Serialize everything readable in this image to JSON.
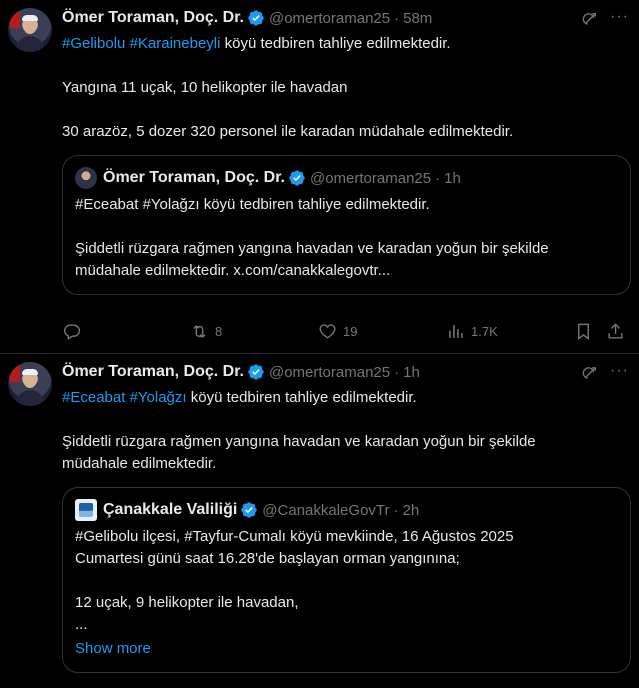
{
  "tweets": [
    {
      "author": "Ömer Toraman, Doç. Dr.",
      "handle": "@omertoraman25",
      "dot": "·",
      "time": "58m",
      "more": "···",
      "line1_tags": [
        "#Gelibolu",
        "#Karainebeyli"
      ],
      "line1_rest": " köyü tedbiren tahliye edilmektedir.",
      "line2": "Yangına 11 uçak, 10 helikopter ile havadan",
      "line3": "30 arazöz, 5 dozer 320 personel ile karadan müdahale edilmektedir.",
      "quote": {
        "author": "Ömer Toraman, Doç. Dr.",
        "handle": "@omertoraman25",
        "dot": "·",
        "time": "1h",
        "line1": "#Eceabat #Yolağzı köyü tedbiren tahliye edilmektedir.",
        "line2": "Şiddetli rüzgara rağmen yangına havadan ve karadan yoğun bir şekilde",
        "line3": "müdahale edilmektedir. x.com/canakkalegovtr..."
      },
      "stats": {
        "retweets": "8",
        "likes": "19",
        "views": "1.7K"
      }
    },
    {
      "author": "Ömer Toraman, Doç. Dr.",
      "handle": "@omertoraman25",
      "dot": "·",
      "time": "1h",
      "more": "···",
      "line1_tags": [
        "#Eceabat",
        "#Yolağzı"
      ],
      "line1_rest": " köyü tedbiren tahliye edilmektedir.",
      "line2": "Şiddetli rüzgara rağmen yangına havadan ve karadan yoğun bir şekilde",
      "line3": "müdahale edilmektedir.",
      "quote": {
        "author": "Çanakkale Valiliği",
        "handle": "@CanakkaleGovTr",
        "dot": "·",
        "time": "2h",
        "line1": "#Gelibolu ilçesi, #Tayfur-Cumalı köyü mevkiinde, 16 Ağustos 2025",
        "line2": "Cumartesi günü saat 16.28'de başlayan orman yangınına;",
        "line3": "12 uçak, 9 helikopter ile havadan,",
        "line4": "...",
        "show_more": "Show more"
      }
    }
  ],
  "colors": {
    "accent": "#1d9bf0",
    "muted": "#71767b",
    "border": "#2f3336"
  }
}
